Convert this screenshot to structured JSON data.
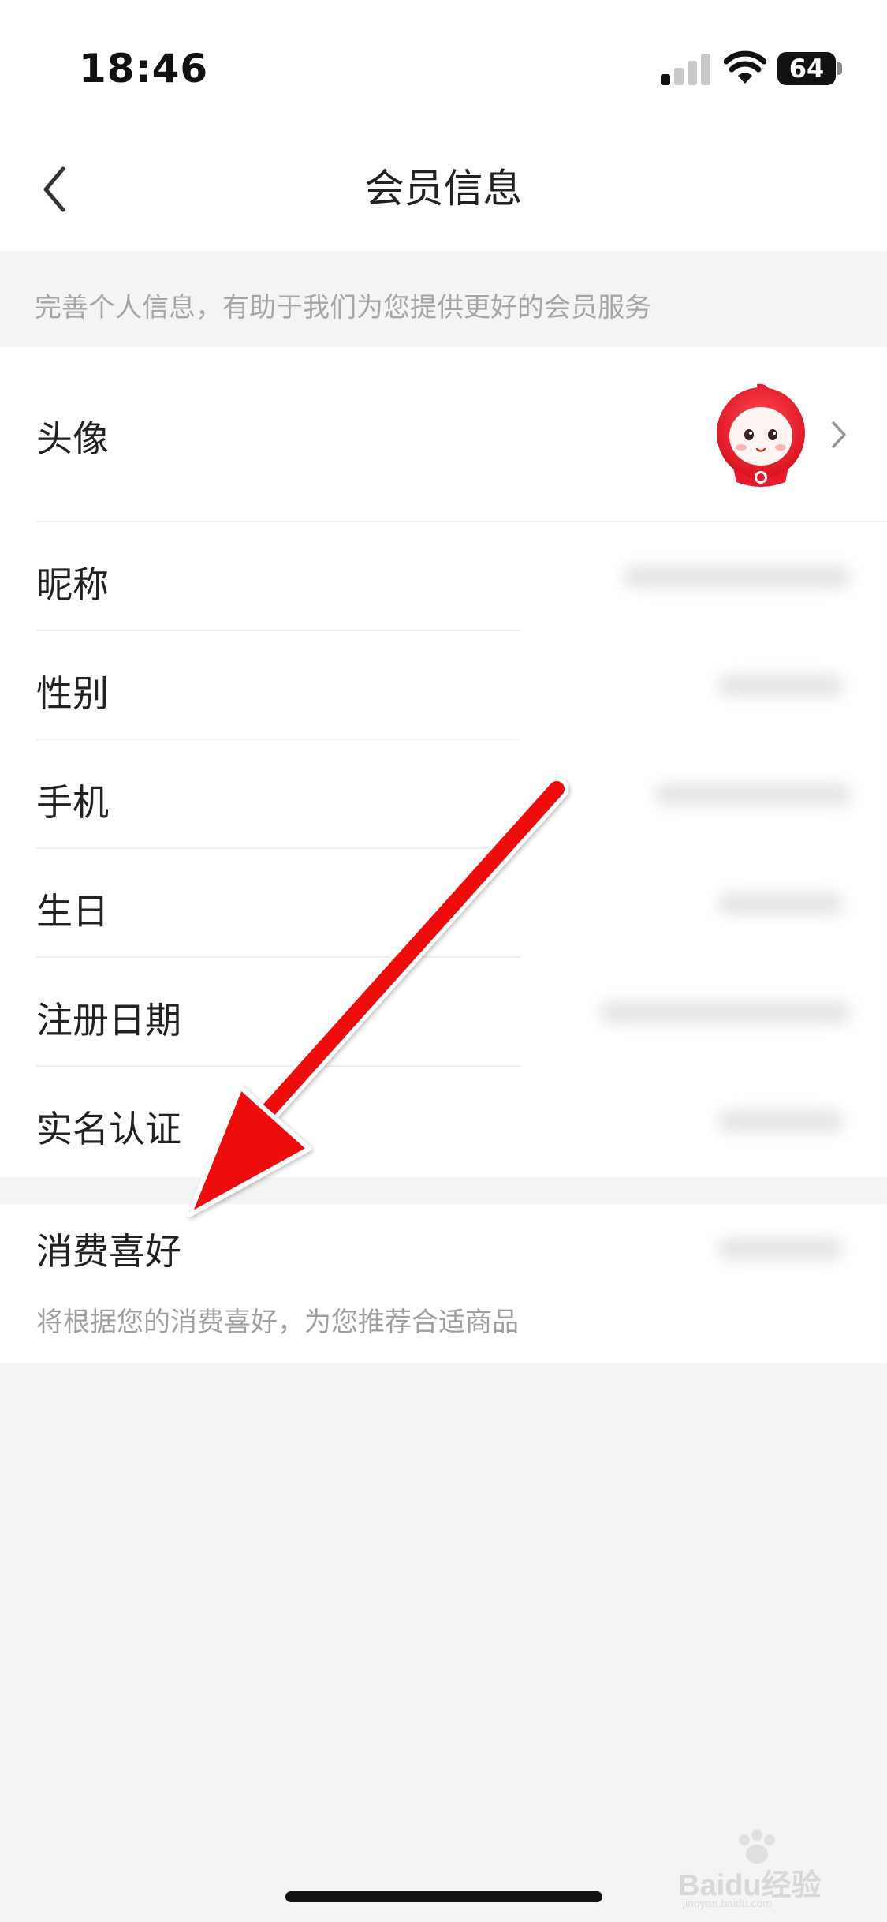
{
  "status_bar": {
    "time": "18:46",
    "battery": "64"
  },
  "nav": {
    "title": "会员信息"
  },
  "tip": {
    "text": "完善个人信息，有助于我们为您提供更好的会员服务"
  },
  "rows": [
    {
      "key": "avatar",
      "label": "头像"
    },
    {
      "key": "nickname",
      "label": "昵称"
    },
    {
      "key": "gender",
      "label": "性别"
    },
    {
      "key": "phone",
      "label": "手机"
    },
    {
      "key": "birthday",
      "label": "生日"
    },
    {
      "key": "register_date",
      "label": "注册日期"
    },
    {
      "key": "realname",
      "label": "实名认证"
    }
  ],
  "preference": {
    "label": "消费喜好",
    "description": "将根据您的消费喜好，为您推荐合适商品"
  },
  "watermark": {
    "text": "Baidu经验",
    "sub": "jingyan.baidu.com"
  },
  "colors": {
    "accent_red": "#e8192c",
    "annotation_arrow": "#ee1111"
  },
  "icons": {
    "back": "chevron-left-icon",
    "disclosure": "chevron-right-icon"
  }
}
